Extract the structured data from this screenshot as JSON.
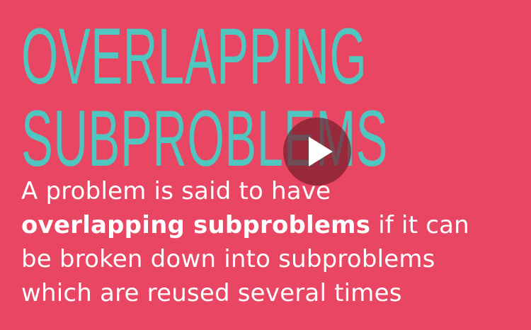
{
  "slide": {
    "title_line_1": "OVERLAPPING",
    "title_line_2": "SUBPROBLEMS",
    "body": {
      "line1": "A problem is said to have",
      "line2_bold": "overlapping subproblems",
      "line2_rest": " if it can",
      "line3": "be broken down into subproblems",
      "line4": "which are reused several times"
    }
  },
  "video": {
    "play_icon": "play-icon"
  },
  "colors": {
    "background": "#e84662",
    "title": "#4fc6c0",
    "body_text": "#ffffff"
  }
}
